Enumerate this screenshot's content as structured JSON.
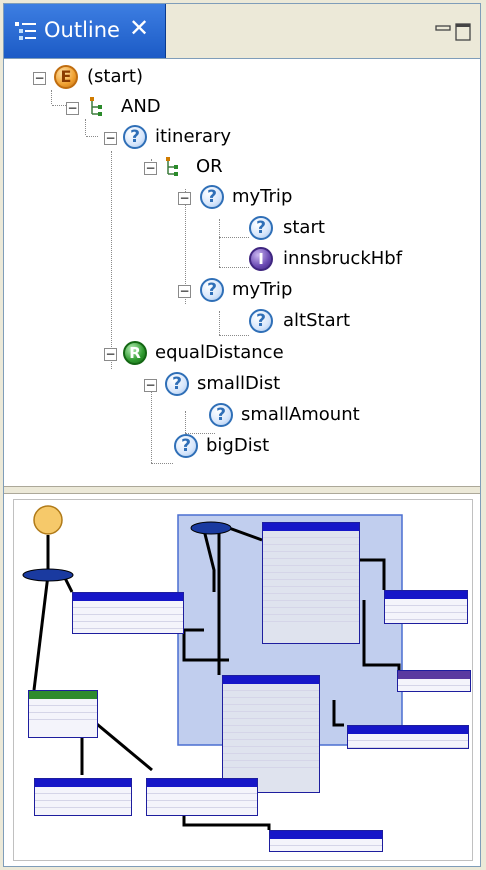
{
  "view": {
    "tab_title": "Outline",
    "close_glyph": "✕",
    "minimize_glyph": "▭",
    "maximize_glyph": "☐"
  },
  "tree": {
    "nodes": [
      {
        "label": "(start)",
        "icon": "e-icon"
      },
      {
        "label": "AND",
        "icon": "and-icon"
      },
      {
        "label": "itinerary",
        "icon": "question-icon"
      },
      {
        "label": "OR",
        "icon": "or-icon"
      },
      {
        "label": "myTrip",
        "icon": "question-icon"
      },
      {
        "label": "start",
        "icon": "question-icon"
      },
      {
        "label": "innsbruckHbf",
        "icon": "i-icon"
      },
      {
        "label": "myTrip",
        "icon": "question-icon"
      },
      {
        "label": "altStart",
        "icon": "question-icon"
      },
      {
        "label": "equalDistance",
        "icon": "r-icon"
      },
      {
        "label": "smallDist",
        "icon": "question-icon"
      },
      {
        "label": "smallAmount",
        "icon": "question-icon"
      },
      {
        "label": "bigDist",
        "icon": "question-icon"
      }
    ],
    "icon_glyphs": {
      "question": "?",
      "e": "E",
      "i": "I",
      "r": "R"
    }
  },
  "colors": {
    "tab_blue": "#1c5bc6",
    "question_blue": "#2f6fb7",
    "e_orange": "#f0a030",
    "i_purple": "#6a4ab3",
    "r_green": "#2f9a2f"
  }
}
